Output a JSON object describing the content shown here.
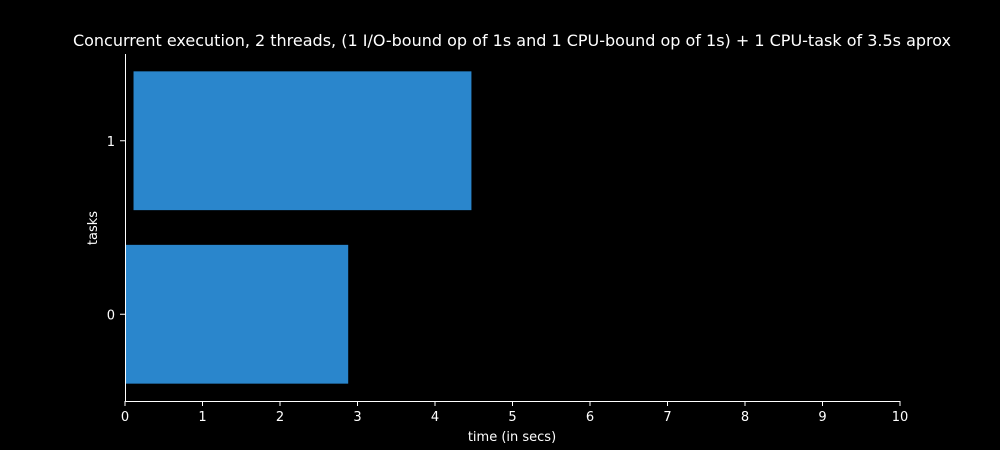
{
  "chart_data": {
    "type": "bar",
    "orientation": "horizontal",
    "title": "Concurrent execution, 2 threads, (1 I/O-bound op of 1s and 1 CPU-bound op of 1s) + 1 CPU-task of 3.5s aprox",
    "xlabel": "time (in secs)",
    "ylabel": "tasks",
    "xlim": [
      0,
      10
    ],
    "ylim": [
      -0.5,
      1.5
    ],
    "xticks": [
      "0",
      "1",
      "2",
      "3",
      "4",
      "5",
      "6",
      "7",
      "8",
      "9",
      "10"
    ],
    "categories": [
      "0",
      "1"
    ],
    "bars": [
      {
        "task": "0",
        "start": 0.0,
        "end": 2.88
      },
      {
        "task": "1",
        "start": 0.11,
        "end": 4.47
      }
    ],
    "grid": false,
    "legend": "none",
    "colors": {
      "background": "#000000",
      "bar": "#2a86cc",
      "axis": "#ffffff",
      "text": "#ffffff"
    }
  }
}
